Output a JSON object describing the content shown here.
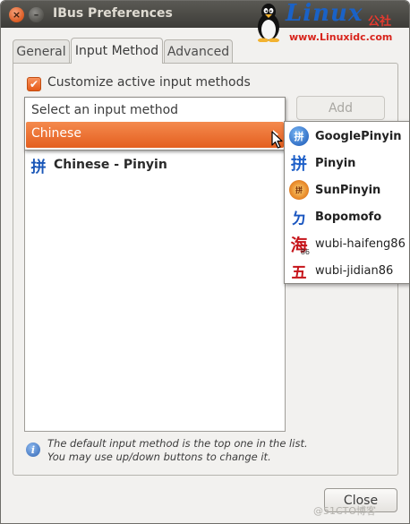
{
  "window": {
    "title": "IBus Preferences"
  },
  "titlebar_buttons": {
    "close": "×",
    "minimize": "–"
  },
  "watermark": {
    "logo": "Linux",
    "chinese": "公社",
    "url": "www.Linuxidc.com"
  },
  "tabs": [
    {
      "label": "General"
    },
    {
      "label": "Input Method",
      "active": true
    },
    {
      "label": "Advanced"
    }
  ],
  "customize": {
    "label": "Customize active input methods",
    "checked": true,
    "check_glyph": "✔"
  },
  "add_button": {
    "label": "Add",
    "enabled": false
  },
  "dropdown": {
    "header": "Select an input method",
    "highlighted": "Chinese"
  },
  "submenu": {
    "items": [
      {
        "label": "GooglePinyin",
        "bold": true,
        "icon": "googlepinyin-icon",
        "glyph": "拼"
      },
      {
        "label": "Pinyin",
        "bold": true,
        "icon": "pinyin-icon",
        "glyph": "拼"
      },
      {
        "label": "SunPinyin",
        "bold": true,
        "icon": "sunpinyin-icon",
        "glyph": "拼"
      },
      {
        "label": "Bopomofo",
        "bold": true,
        "icon": "bopomofo-icon",
        "glyph": "ㄉ"
      },
      {
        "label": "wubi-haifeng86",
        "bold": false,
        "icon": "wubi-haifeng-icon",
        "glyph": "海",
        "subglyph": "86"
      },
      {
        "label": "wubi-jidian86",
        "bold": false,
        "icon": "wubi-jidian-icon",
        "glyph": "五"
      }
    ]
  },
  "active_list": {
    "items": [
      {
        "label": "Chinese - Pinyin",
        "glyph": "拼"
      }
    ]
  },
  "info": {
    "line1": "The default input method is the top one in the list.",
    "line2": "You may use up/down buttons to change it."
  },
  "close_button": {
    "label": "Close"
  },
  "bottom_watermark": "@51CTO博客",
  "colors": {
    "accent": "#e8631f",
    "title_bar": "#3d3c38",
    "background": "#f2f1ef"
  }
}
